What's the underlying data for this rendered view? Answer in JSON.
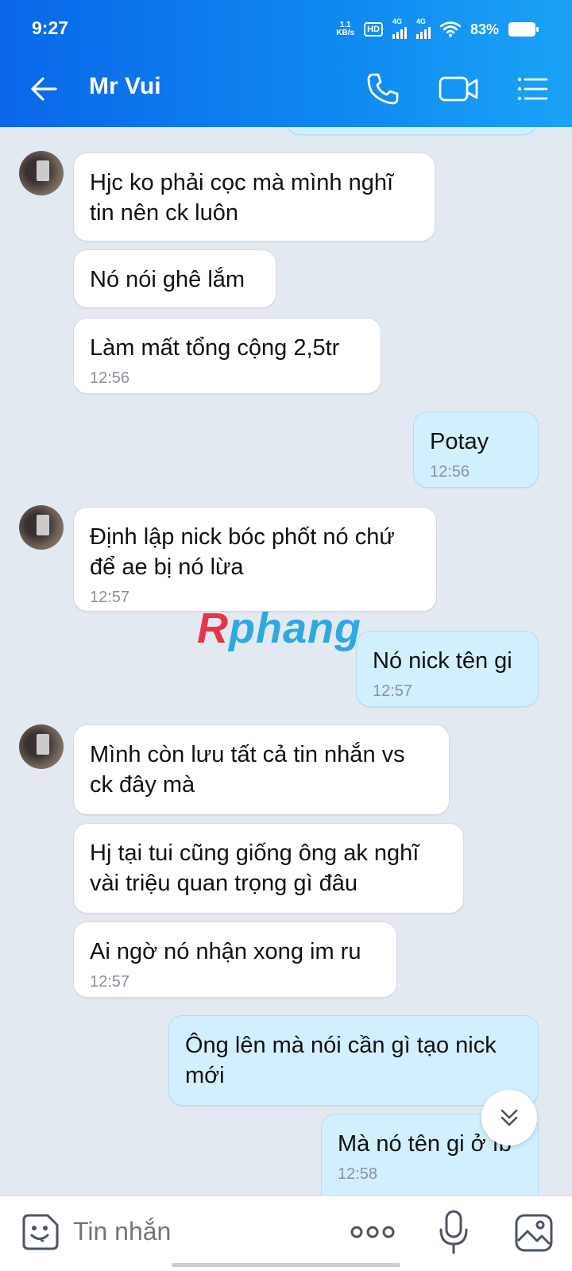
{
  "status_bar": {
    "time": "9:27",
    "net_speed_value": "1.1",
    "net_speed_unit": "KB/s",
    "hd_label": "HD",
    "sim1_label": "4G",
    "sim2_label": "4G",
    "battery": "83%"
  },
  "header": {
    "title": "Mr Vui",
    "icons": [
      "back-arrow-icon",
      "phone-icon",
      "video-call-icon",
      "menu-list-icon"
    ]
  },
  "watermark": {
    "part1": "R",
    "part2": "phang"
  },
  "messages": [
    {
      "side": "in",
      "text_lines": [
        "Hjc ko phải cọc mà mình nghĩ",
        "tin nên ck luôn"
      ],
      "time": ""
    },
    {
      "side": "in",
      "text_lines": [
        "Nó nói ghê lắm"
      ],
      "time": ""
    },
    {
      "side": "in",
      "text_lines": [
        "Làm mất tổng cộng 2,5tr"
      ],
      "time": "12:56"
    },
    {
      "side": "out",
      "text_lines": [
        "Potay"
      ],
      "time": "12:56"
    },
    {
      "side": "in",
      "text_lines": [
        "Định lập nick bóc phốt nó chứ",
        "để ae bị nó lừa"
      ],
      "time": "12:57"
    },
    {
      "side": "out",
      "text_lines": [
        "Nó nick tên gi"
      ],
      "time": "12:57"
    },
    {
      "side": "in",
      "text_lines": [
        "Mình còn lưu tất cả tin nhắn vs",
        "ck đây mà"
      ],
      "time": ""
    },
    {
      "side": "in",
      "text_lines": [
        "Hj tại tui cũng giống ông ak nghĩ",
        "vài triệu quan trọng gì đâu"
      ],
      "time": ""
    },
    {
      "side": "in",
      "text_lines": [
        "Ai ngờ nó nhận xong im ru"
      ],
      "time": "12:57"
    },
    {
      "side": "out",
      "text_lines": [
        "Ông lên mà nói cần gì tạo nick",
        "mới"
      ],
      "time": ""
    },
    {
      "side": "out",
      "text_lines": [
        "Mà nó tên gi ở fb"
      ],
      "time": "12:58"
    }
  ],
  "composer": {
    "placeholder": "Tin nhắn"
  },
  "colors": {
    "header_start": "#0a67e8",
    "header_end": "#1aa3f6",
    "chat_bg": "#e2e9f1",
    "incoming_bubble": "#ffffff",
    "outgoing_bubble": "#d2efff"
  }
}
